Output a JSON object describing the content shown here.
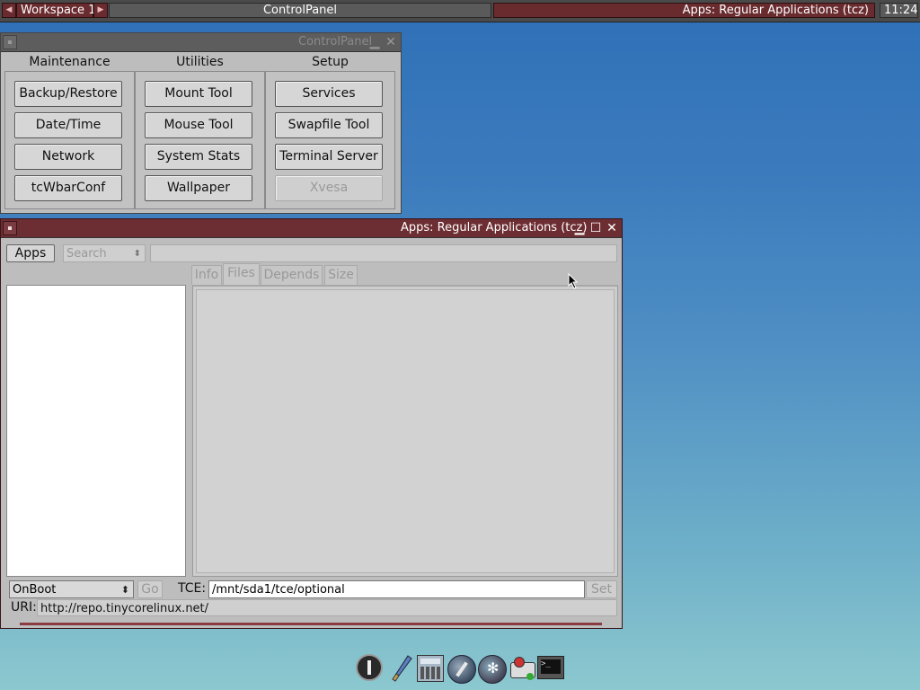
{
  "taskbar": {
    "workspace": "Workspace 1",
    "center_title": "ControlPanel",
    "active_window": "Apps: Regular Applications (tcz)",
    "clock": "11:24"
  },
  "control_panel": {
    "title": "ControlPanel",
    "columns": [
      {
        "heading": "Maintenance",
        "buttons": [
          "Backup/Restore",
          "Date/Time",
          "Network",
          "tcWbarConf"
        ]
      },
      {
        "heading": "Utilities",
        "buttons": [
          "Mount Tool",
          "Mouse Tool",
          "System Stats",
          "Wallpaper"
        ]
      },
      {
        "heading": "Setup",
        "buttons": [
          "Services",
          "Swapfile Tool",
          "Terminal Server",
          "Xvesa"
        ]
      }
    ]
  },
  "apps_window": {
    "title": "Apps: Regular Applications (tcz)",
    "apps_button": "Apps",
    "search_mode": "Search",
    "search_value": "",
    "tabs": [
      "Info",
      "Files",
      "Depends",
      "Size"
    ],
    "selected_tab": "Files",
    "install_mode": "OnBoot",
    "go_label": "Go",
    "tce_label": "TCE:",
    "tce_path": "/mnt/sda1/tce/optional",
    "set_label": "Set",
    "uri_label": "URI:",
    "uri_value": "http://repo.tinycorelinux.net/"
  },
  "dock": {
    "icons": [
      "power-icon",
      "brush-icon",
      "calculator-icon",
      "mount-icon",
      "run-icon",
      "control-panel-icon",
      "terminal-icon"
    ]
  },
  "colors": {
    "title_active": "#6d2e33",
    "title_inactive": "#5d5d5d",
    "desktop_top": "#2f6fb6",
    "desktop_bottom": "#8cc8cf"
  }
}
